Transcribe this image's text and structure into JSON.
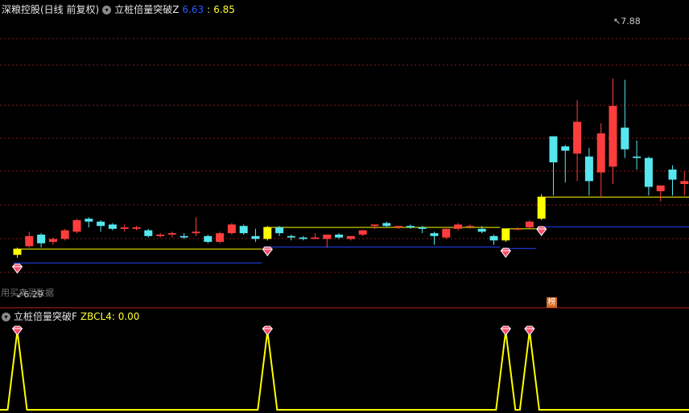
{
  "main_panel": {
    "title": "深粮控股(日线 前复权)",
    "indicator_name": "立桩倍量突破Z",
    "value_a": "6.63",
    "separator": ":",
    "value_b": "6.85",
    "high_marker": "7.88",
    "low_marker": "6.29",
    "watermark": "用买卖买数据",
    "badge": "榜"
  },
  "sub_panel": {
    "indicator_name": "立桩倍量突破F",
    "label": "ZBCL4: 0.00"
  },
  "colors": {
    "up": "#ff3d3d",
    "down": "#55e6ef",
    "signal": "#ffff00",
    "blue_line": "#2244ff",
    "grid": "#8b1a1a",
    "gem": "#ff4d6a"
  },
  "chart_data": [
    {
      "type": "candlestick",
      "title": "深粮控股(日线 前复权)",
      "ylim": [
        6.15,
        7.95
      ],
      "candles": [
        {
          "o": 6.31,
          "h": 6.36,
          "l": 6.29,
          "c": 6.35,
          "signal": true
        },
        {
          "o": 6.37,
          "h": 6.47,
          "l": 6.36,
          "c": 6.44
        },
        {
          "o": 6.45,
          "h": 6.46,
          "l": 6.36,
          "c": 6.39
        },
        {
          "o": 6.4,
          "h": 6.43,
          "l": 6.38,
          "c": 6.42
        },
        {
          "o": 6.42,
          "h": 6.49,
          "l": 6.41,
          "c": 6.48
        },
        {
          "o": 6.47,
          "h": 6.56,
          "l": 6.46,
          "c": 6.55
        },
        {
          "o": 6.56,
          "h": 6.57,
          "l": 6.5,
          "c": 6.54
        },
        {
          "o": 6.54,
          "h": 6.55,
          "l": 6.47,
          "c": 6.51
        },
        {
          "o": 6.52,
          "h": 6.53,
          "l": 6.48,
          "c": 6.49
        },
        {
          "o": 6.49,
          "h": 6.52,
          "l": 6.47,
          "c": 6.5
        },
        {
          "o": 6.49,
          "h": 6.51,
          "l": 6.48,
          "c": 6.5
        },
        {
          "o": 6.48,
          "h": 6.49,
          "l": 6.43,
          "c": 6.44
        },
        {
          "o": 6.44,
          "h": 6.46,
          "l": 6.43,
          "c": 6.45
        },
        {
          "o": 6.45,
          "h": 6.47,
          "l": 6.43,
          "c": 6.46
        },
        {
          "o": 6.44,
          "h": 6.46,
          "l": 6.42,
          "c": 6.43
        },
        {
          "o": 6.46,
          "h": 6.57,
          "l": 6.44,
          "c": 6.47
        },
        {
          "o": 6.44,
          "h": 6.45,
          "l": 6.39,
          "c": 6.4
        },
        {
          "o": 6.4,
          "h": 6.47,
          "l": 6.39,
          "c": 6.46
        },
        {
          "o": 6.46,
          "h": 6.53,
          "l": 6.45,
          "c": 6.52
        },
        {
          "o": 6.51,
          "h": 6.52,
          "l": 6.45,
          "c": 6.46
        },
        {
          "o": 6.44,
          "h": 6.49,
          "l": 6.4,
          "c": 6.42
        },
        {
          "o": 6.42,
          "h": 6.51,
          "l": 6.41,
          "c": 6.5,
          "signal": true
        },
        {
          "o": 6.5,
          "h": 6.51,
          "l": 6.44,
          "c": 6.46
        },
        {
          "o": 6.44,
          "h": 6.45,
          "l": 6.41,
          "c": 6.43
        },
        {
          "o": 6.43,
          "h": 6.44,
          "l": 6.41,
          "c": 6.42
        },
        {
          "o": 6.42,
          "h": 6.46,
          "l": 6.42,
          "c": 6.43
        },
        {
          "o": 6.42,
          "h": 6.45,
          "l": 6.36,
          "c": 6.45
        },
        {
          "o": 6.45,
          "h": 6.46,
          "l": 6.42,
          "c": 6.43
        },
        {
          "o": 6.42,
          "h": 6.44,
          "l": 6.41,
          "c": 6.44
        },
        {
          "o": 6.45,
          "h": 6.48,
          "l": 6.44,
          "c": 6.48
        },
        {
          "o": 6.51,
          "h": 6.52,
          "l": 6.49,
          "c": 6.52
        },
        {
          "o": 6.53,
          "h": 6.54,
          "l": 6.5,
          "c": 6.51
        },
        {
          "o": 6.5,
          "h": 6.51,
          "l": 6.49,
          "c": 6.51
        },
        {
          "o": 6.51,
          "h": 6.52,
          "l": 6.49,
          "c": 6.5
        },
        {
          "o": 6.5,
          "h": 6.51,
          "l": 6.46,
          "c": 6.49
        },
        {
          "o": 6.46,
          "h": 6.47,
          "l": 6.38,
          "c": 6.44
        },
        {
          "o": 6.43,
          "h": 6.49,
          "l": 6.42,
          "c": 6.49
        },
        {
          "o": 6.49,
          "h": 6.53,
          "l": 6.48,
          "c": 6.52
        },
        {
          "o": 6.51,
          "h": 6.52,
          "l": 6.49,
          "c": 6.51
        },
        {
          "o": 6.49,
          "h": 6.51,
          "l": 6.46,
          "c": 6.47
        },
        {
          "o": 6.44,
          "h": 6.45,
          "l": 6.38,
          "c": 6.41
        },
        {
          "o": 6.41,
          "h": 6.49,
          "l": 6.4,
          "c": 6.49,
          "signal": true
        },
        {
          "o": 6.49,
          "h": 6.5,
          "l": 6.48,
          "c": 6.49
        },
        {
          "o": 6.5,
          "h": 6.55,
          "l": 6.49,
          "c": 6.54
        },
        {
          "o": 6.56,
          "h": 6.73,
          "l": 6.55,
          "c": 6.71,
          "signal": true
        },
        {
          "o": 7.13,
          "h": 7.13,
          "l": 6.72,
          "c": 6.95
        },
        {
          "o": 7.06,
          "h": 7.07,
          "l": 6.81,
          "c": 7.03
        },
        {
          "o": 7.01,
          "h": 7.38,
          "l": 6.82,
          "c": 7.23
        },
        {
          "o": 6.99,
          "h": 7.05,
          "l": 6.72,
          "c": 6.82
        },
        {
          "o": 6.88,
          "h": 7.22,
          "l": 6.71,
          "c": 7.15
        },
        {
          "o": 6.92,
          "h": 7.53,
          "l": 6.8,
          "c": 7.34
        },
        {
          "o": 7.19,
          "h": 7.52,
          "l": 6.98,
          "c": 7.04
        },
        {
          "o": 6.99,
          "h": 7.1,
          "l": 6.9,
          "c": 6.98
        },
        {
          "o": 6.98,
          "h": 6.99,
          "l": 6.72,
          "c": 6.78
        },
        {
          "o": 6.75,
          "h": 6.78,
          "l": 6.68,
          "c": 6.79
        },
        {
          "o": 6.9,
          "h": 6.93,
          "l": 6.72,
          "c": 6.83
        },
        {
          "o": 6.8,
          "h": 6.89,
          "l": 6.72,
          "c": 6.82
        }
      ]
    },
    {
      "type": "line",
      "series": [
        {
          "name": "ZBCL4",
          "values": [
            1,
            0,
            0,
            0,
            0,
            0,
            0,
            0,
            0,
            0,
            0,
            0,
            0,
            0,
            0,
            0,
            0,
            0,
            0,
            0,
            0,
            1,
            0,
            0,
            0,
            0,
            0,
            0,
            0,
            0,
            0,
            0,
            0,
            0,
            0,
            0,
            0,
            0,
            0,
            0,
            0,
            1,
            0,
            1,
            0,
            0,
            0,
            0,
            0,
            0,
            0,
            0,
            0,
            0,
            0,
            0,
            0
          ]
        }
      ],
      "ylim": [
        0,
        1
      ]
    }
  ]
}
